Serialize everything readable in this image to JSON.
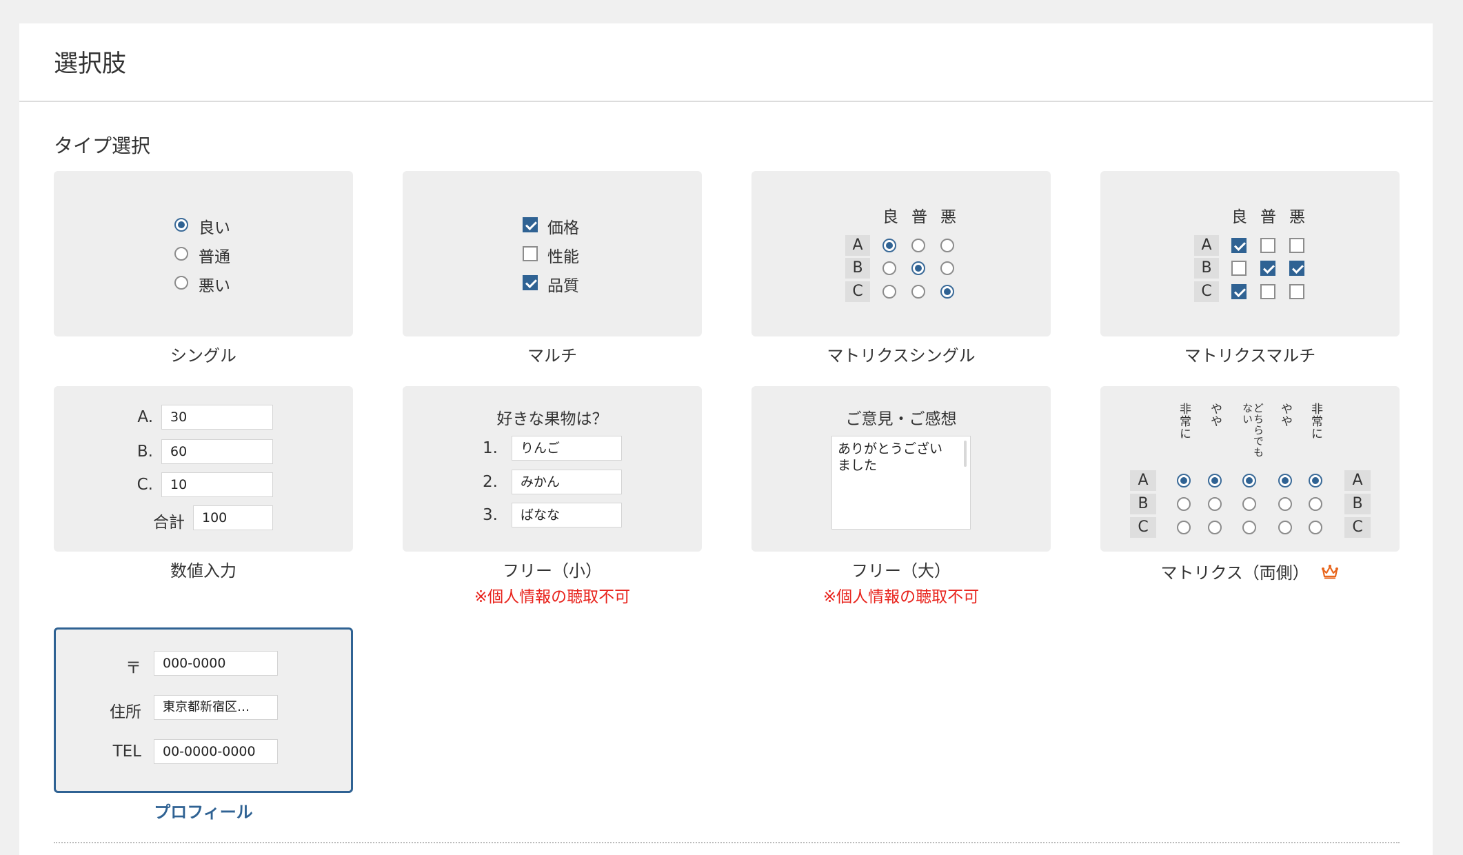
{
  "page_title": "選択肢",
  "section_title": "タイプ選択",
  "cards": {
    "single": {
      "caption": "シングル",
      "options": [
        "良い",
        "普通",
        "悪い"
      ],
      "selected_index": 0
    },
    "multi": {
      "caption": "マルチ",
      "options": [
        {
          "label": "価格",
          "checked": true
        },
        {
          "label": "性能",
          "checked": false
        },
        {
          "label": "品質",
          "checked": true
        }
      ]
    },
    "matrix_single": {
      "caption": "マトリクスシングル",
      "columns": [
        "良",
        "普",
        "悪"
      ],
      "rows": [
        "A",
        "B",
        "C"
      ],
      "selected": [
        0,
        1,
        2
      ]
    },
    "matrix_multi": {
      "caption": "マトリクスマルチ",
      "columns": [
        "良",
        "普",
        "悪"
      ],
      "rows": [
        "A",
        "B",
        "C"
      ],
      "checked": [
        [
          true,
          false,
          false
        ],
        [
          false,
          true,
          true
        ],
        [
          true,
          false,
          false
        ]
      ]
    },
    "numeric": {
      "caption": "数値入力",
      "rows": [
        {
          "label": "A.",
          "value": "30"
        },
        {
          "label": "B.",
          "value": "60"
        },
        {
          "label": "C.",
          "value": "10"
        }
      ],
      "total_label": "合計",
      "total_value": "100"
    },
    "free_small": {
      "caption": "フリー（小）",
      "warning": "※個人情報の聴取不可",
      "question": "好きな果物は？",
      "rows": [
        {
          "label": "1.",
          "value": "りんご"
        },
        {
          "label": "2.",
          "value": "みかん"
        },
        {
          "label": "3.",
          "value": "ばなな"
        }
      ]
    },
    "free_large": {
      "caption": "フリー（大）",
      "warning": "※個人情報の聴取不可",
      "question": "ご意見・ご感想",
      "textarea_value": "ありがとうございました"
    },
    "matrix_both": {
      "caption": "マトリクス（両側）",
      "columns": [
        "非常に",
        "やや",
        "どちらでもない",
        "やや",
        "非常に"
      ],
      "rows": [
        "A",
        "B",
        "C"
      ],
      "selected_row": 0,
      "badge_icon": "crown-icon",
      "badge_color": "#e8651c"
    },
    "profile": {
      "caption": "プロフィール",
      "selected": true,
      "fields": [
        {
          "label": "〒",
          "value": "000-0000"
        },
        {
          "label": "住所",
          "value": "東京都新宿区…"
        },
        {
          "label": "TEL",
          "value": "00-0000-0000"
        }
      ]
    }
  },
  "colors": {
    "accent": "#2f6293",
    "warning": "#e8231c",
    "card_bg": "#eeeeee",
    "page_bg": "#f0f0f0"
  }
}
